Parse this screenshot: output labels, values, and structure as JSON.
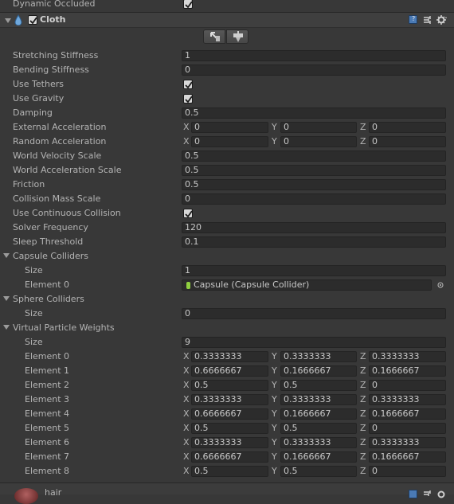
{
  "prev_component": {
    "label": "Dynamic Occluded",
    "checked": true
  },
  "component": {
    "title": "Cloth",
    "enabled": true
  },
  "icons": {
    "foldout": "triangle-down-icon",
    "cloth": "cloth-droplet-icon",
    "help": "help-book-icon",
    "preset": "preset-icon",
    "settings": "gear-icon",
    "edit_constraints": "edit-constraints-icon",
    "paint": "paint-icon",
    "object_picker": "object-picker-icon",
    "collider": "capsule-collider-icon"
  },
  "props": {
    "stretching_stiffness": {
      "label": "Stretching Stiffness",
      "value": "1"
    },
    "bending_stiffness": {
      "label": "Bending Stiffness",
      "value": "0"
    },
    "use_tethers": {
      "label": "Use Tethers",
      "checked": true
    },
    "use_gravity": {
      "label": "Use Gravity",
      "checked": true
    },
    "damping": {
      "label": "Damping",
      "value": "0.5"
    },
    "external_acceleration": {
      "label": "External Acceleration",
      "x": "0",
      "y": "0",
      "z": "0"
    },
    "random_acceleration": {
      "label": "Random Acceleration",
      "x": "0",
      "y": "0",
      "z": "0"
    },
    "world_velocity_scale": {
      "label": "World Velocity Scale",
      "value": "0.5"
    },
    "world_acceleration_scale": {
      "label": "World Acceleration Scale",
      "value": "0.5"
    },
    "friction": {
      "label": "Friction",
      "value": "0.5"
    },
    "collision_mass_scale": {
      "label": "Collision Mass Scale",
      "value": "0"
    },
    "use_continuous_collision": {
      "label": "Use Continuous Collision",
      "checked": true
    },
    "solver_frequency": {
      "label": "Solver Frequency",
      "value": "120"
    },
    "sleep_threshold": {
      "label": "Sleep Threshold",
      "value": "0.1"
    }
  },
  "axis": {
    "x": "X",
    "y": "Y",
    "z": "Z"
  },
  "capsule_colliders": {
    "label": "Capsule Colliders",
    "size_label": "Size",
    "size": "1",
    "element_label": "Element 0",
    "element_value": "Capsule (Capsule Collider)"
  },
  "sphere_colliders": {
    "label": "Sphere Colliders",
    "size_label": "Size",
    "size": "0"
  },
  "virtual_particle_weights": {
    "label": "Virtual Particle Weights",
    "size_label": "Size",
    "size": "9",
    "elements": [
      {
        "label": "Element 0",
        "x": "0.3333333",
        "y": "0.3333333",
        "z": "0.3333333"
      },
      {
        "label": "Element 1",
        "x": "0.6666667",
        "y": "0.1666667",
        "z": "0.1666667"
      },
      {
        "label": "Element 2",
        "x": "0.5",
        "y": "0.5",
        "z": "0"
      },
      {
        "label": "Element 3",
        "x": "0.3333333",
        "y": "0.3333333",
        "z": "0.3333333"
      },
      {
        "label": "Element 4",
        "x": "0.6666667",
        "y": "0.1666667",
        "z": "0.1666667"
      },
      {
        "label": "Element 5",
        "x": "0.5",
        "y": "0.5",
        "z": "0"
      },
      {
        "label": "Element 6",
        "x": "0.3333333",
        "y": "0.3333333",
        "z": "0.3333333"
      },
      {
        "label": "Element 7",
        "x": "0.6666667",
        "y": "0.1666667",
        "z": "0.1666667"
      },
      {
        "label": "Element 8",
        "x": "0.5",
        "y": "0.5",
        "z": "0"
      }
    ]
  },
  "next_component": {
    "label": "hair"
  }
}
